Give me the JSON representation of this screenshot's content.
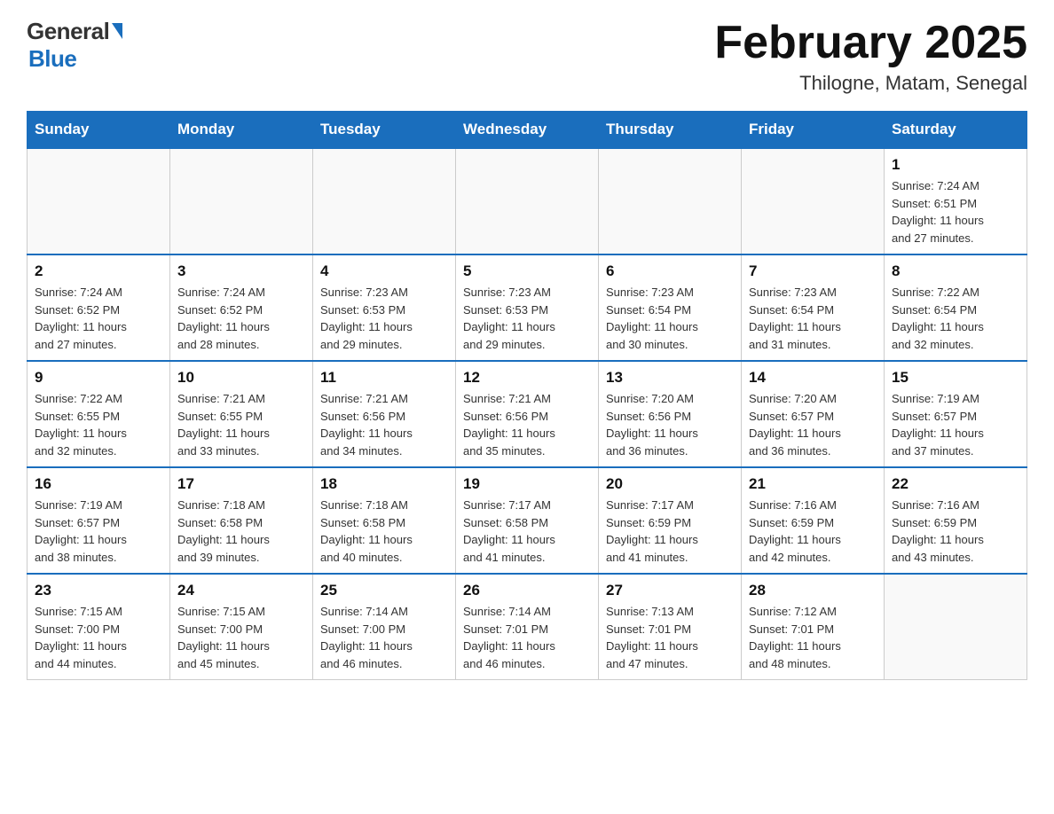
{
  "header": {
    "logo_general": "General",
    "logo_blue": "Blue",
    "title": "February 2025",
    "subtitle": "Thilogne, Matam, Senegal"
  },
  "days_of_week": [
    "Sunday",
    "Monday",
    "Tuesday",
    "Wednesday",
    "Thursday",
    "Friday",
    "Saturday"
  ],
  "weeks": [
    [
      {
        "day": "",
        "info": ""
      },
      {
        "day": "",
        "info": ""
      },
      {
        "day": "",
        "info": ""
      },
      {
        "day": "",
        "info": ""
      },
      {
        "day": "",
        "info": ""
      },
      {
        "day": "",
        "info": ""
      },
      {
        "day": "1",
        "info": "Sunrise: 7:24 AM\nSunset: 6:51 PM\nDaylight: 11 hours\nand 27 minutes."
      }
    ],
    [
      {
        "day": "2",
        "info": "Sunrise: 7:24 AM\nSunset: 6:52 PM\nDaylight: 11 hours\nand 27 minutes."
      },
      {
        "day": "3",
        "info": "Sunrise: 7:24 AM\nSunset: 6:52 PM\nDaylight: 11 hours\nand 28 minutes."
      },
      {
        "day": "4",
        "info": "Sunrise: 7:23 AM\nSunset: 6:53 PM\nDaylight: 11 hours\nand 29 minutes."
      },
      {
        "day": "5",
        "info": "Sunrise: 7:23 AM\nSunset: 6:53 PM\nDaylight: 11 hours\nand 29 minutes."
      },
      {
        "day": "6",
        "info": "Sunrise: 7:23 AM\nSunset: 6:54 PM\nDaylight: 11 hours\nand 30 minutes."
      },
      {
        "day": "7",
        "info": "Sunrise: 7:23 AM\nSunset: 6:54 PM\nDaylight: 11 hours\nand 31 minutes."
      },
      {
        "day": "8",
        "info": "Sunrise: 7:22 AM\nSunset: 6:54 PM\nDaylight: 11 hours\nand 32 minutes."
      }
    ],
    [
      {
        "day": "9",
        "info": "Sunrise: 7:22 AM\nSunset: 6:55 PM\nDaylight: 11 hours\nand 32 minutes."
      },
      {
        "day": "10",
        "info": "Sunrise: 7:21 AM\nSunset: 6:55 PM\nDaylight: 11 hours\nand 33 minutes."
      },
      {
        "day": "11",
        "info": "Sunrise: 7:21 AM\nSunset: 6:56 PM\nDaylight: 11 hours\nand 34 minutes."
      },
      {
        "day": "12",
        "info": "Sunrise: 7:21 AM\nSunset: 6:56 PM\nDaylight: 11 hours\nand 35 minutes."
      },
      {
        "day": "13",
        "info": "Sunrise: 7:20 AM\nSunset: 6:56 PM\nDaylight: 11 hours\nand 36 minutes."
      },
      {
        "day": "14",
        "info": "Sunrise: 7:20 AM\nSunset: 6:57 PM\nDaylight: 11 hours\nand 36 minutes."
      },
      {
        "day": "15",
        "info": "Sunrise: 7:19 AM\nSunset: 6:57 PM\nDaylight: 11 hours\nand 37 minutes."
      }
    ],
    [
      {
        "day": "16",
        "info": "Sunrise: 7:19 AM\nSunset: 6:57 PM\nDaylight: 11 hours\nand 38 minutes."
      },
      {
        "day": "17",
        "info": "Sunrise: 7:18 AM\nSunset: 6:58 PM\nDaylight: 11 hours\nand 39 minutes."
      },
      {
        "day": "18",
        "info": "Sunrise: 7:18 AM\nSunset: 6:58 PM\nDaylight: 11 hours\nand 40 minutes."
      },
      {
        "day": "19",
        "info": "Sunrise: 7:17 AM\nSunset: 6:58 PM\nDaylight: 11 hours\nand 41 minutes."
      },
      {
        "day": "20",
        "info": "Sunrise: 7:17 AM\nSunset: 6:59 PM\nDaylight: 11 hours\nand 41 minutes."
      },
      {
        "day": "21",
        "info": "Sunrise: 7:16 AM\nSunset: 6:59 PM\nDaylight: 11 hours\nand 42 minutes."
      },
      {
        "day": "22",
        "info": "Sunrise: 7:16 AM\nSunset: 6:59 PM\nDaylight: 11 hours\nand 43 minutes."
      }
    ],
    [
      {
        "day": "23",
        "info": "Sunrise: 7:15 AM\nSunset: 7:00 PM\nDaylight: 11 hours\nand 44 minutes."
      },
      {
        "day": "24",
        "info": "Sunrise: 7:15 AM\nSunset: 7:00 PM\nDaylight: 11 hours\nand 45 minutes."
      },
      {
        "day": "25",
        "info": "Sunrise: 7:14 AM\nSunset: 7:00 PM\nDaylight: 11 hours\nand 46 minutes."
      },
      {
        "day": "26",
        "info": "Sunrise: 7:14 AM\nSunset: 7:01 PM\nDaylight: 11 hours\nand 46 minutes."
      },
      {
        "day": "27",
        "info": "Sunrise: 7:13 AM\nSunset: 7:01 PM\nDaylight: 11 hours\nand 47 minutes."
      },
      {
        "day": "28",
        "info": "Sunrise: 7:12 AM\nSunset: 7:01 PM\nDaylight: 11 hours\nand 48 minutes."
      },
      {
        "day": "",
        "info": ""
      }
    ]
  ]
}
